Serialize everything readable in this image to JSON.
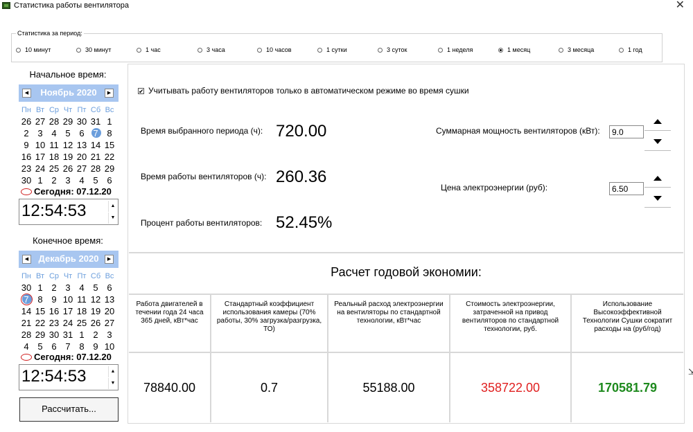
{
  "window": {
    "title": "Статистика работы вентилятора",
    "close_label": "✕"
  },
  "period": {
    "legend": "Статистика за период:",
    "options": [
      "10 минут",
      "30 минут",
      "1 час",
      "3 часа",
      "10 часов",
      "1 сутки",
      "3 суток",
      "1 неделя",
      "1 месяц",
      "3 месяца",
      "1 год"
    ],
    "selected": "1 месяц"
  },
  "start": {
    "label": "Начальное время:",
    "month": "Ноябрь 2020",
    "weekdays": [
      "Пн",
      "Вт",
      "Ср",
      "Чт",
      "Пт",
      "Сб",
      "Вс"
    ],
    "days": [
      "26",
      "27",
      "28",
      "29",
      "30",
      "31",
      "1",
      "2",
      "3",
      "4",
      "5",
      "6",
      "7",
      "8",
      "9",
      "10",
      "11",
      "12",
      "13",
      "14",
      "15",
      "16",
      "17",
      "18",
      "19",
      "20",
      "21",
      "22",
      "23",
      "24",
      "25",
      "26",
      "27",
      "28",
      "29",
      "30",
      "1",
      "2",
      "3",
      "4",
      "5",
      "6"
    ],
    "selected_day": "7",
    "today": "Сегодня: 07.12.20",
    "time": "12:54:53"
  },
  "end": {
    "label": "Конечное время:",
    "month": "Декабрь 2020",
    "weekdays": [
      "Пн",
      "Вт",
      "Ср",
      "Чт",
      "Пт",
      "Сб",
      "Вс"
    ],
    "days": [
      "30",
      "1",
      "2",
      "3",
      "4",
      "5",
      "6",
      "7",
      "8",
      "9",
      "10",
      "11",
      "12",
      "13",
      "14",
      "15",
      "16",
      "17",
      "18",
      "19",
      "20",
      "21",
      "22",
      "23",
      "24",
      "25",
      "26",
      "27",
      "28",
      "29",
      "30",
      "31",
      "1",
      "2",
      "3",
      "4",
      "5",
      "6",
      "7",
      "8",
      "9",
      "10"
    ],
    "selected_day": "7",
    "today": "Сегодня: 07.12.20",
    "time": "12:54:53"
  },
  "calc_button": "Рассчитать...",
  "auto_mode": {
    "label": "Учитывать работу вентиляторов только в автоматическом режиме во время сушки",
    "checked": true,
    "mark": "✔"
  },
  "stats": {
    "period_label": "Время выбранного периода (ч):",
    "period_value": "720.00",
    "work_label": "Время работы вентиляторов (ч):",
    "work_value": "260.36",
    "percent_label": "Процент работы вентиляторов:",
    "percent_value": "52.45%"
  },
  "power": {
    "label": "Суммарная мощность вентиляторов (кВт):",
    "value": "9.0"
  },
  "price": {
    "label": "Цена электроэнергии (руб):",
    "value": "6.50"
  },
  "economy": {
    "title": "Расчет годовой экономии:",
    "columns": [
      {
        "header": "Работа двигателей в течении года 24 часа 365 дней, кВт*час",
        "value": "78840.00",
        "color": "#000000"
      },
      {
        "header": "Стандартный коэффициент использования камеры (70% работы, 30% загрузка/разгрузка, ТО)",
        "value": "0.7",
        "color": "#000000"
      },
      {
        "header": "Реальный расход электроэнергии на вентиляторы по стандартной технологии, кВт*час",
        "value": "55188.00",
        "color": "#000000"
      },
      {
        "header": "Стоимость электроэнергии, затраченной на привод вентиляторов по стандартной технологии, руб.",
        "value": "358722.00",
        "color": "#e02020"
      },
      {
        "header": "Использование Высокоэффективной Технологии Сушки сократит расходы на (руб/год)",
        "value": "170581.79",
        "color": "#1e8a1e"
      }
    ]
  }
}
